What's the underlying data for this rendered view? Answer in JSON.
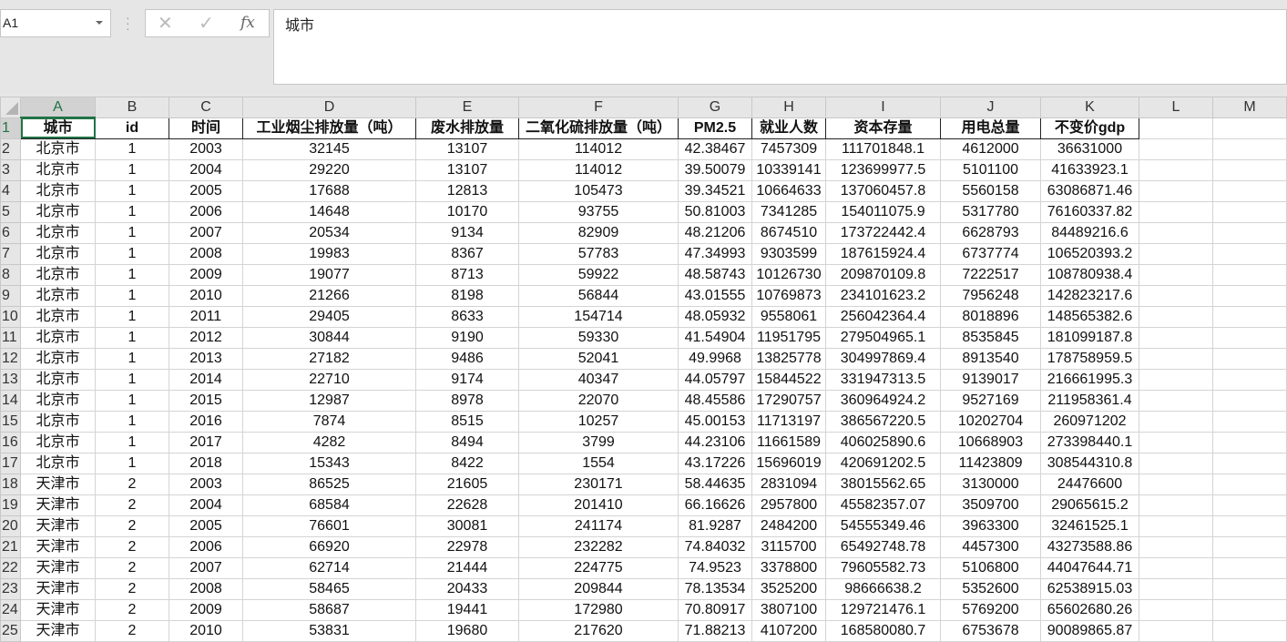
{
  "namebox": "A1",
  "formula_bar": {
    "cancel_icon": "✕",
    "enter_icon": "✓",
    "fx_label": "fx",
    "content": "城市"
  },
  "column_letters": [
    "A",
    "B",
    "C",
    "D",
    "E",
    "F",
    "G",
    "H",
    "I",
    "J",
    "K",
    "L",
    "M"
  ],
  "headers": [
    "城市",
    "id",
    "时间",
    "工业烟尘排放量（吨）",
    "废水排放量",
    "二氧化硫排放量（吨）",
    "PM2.5",
    "就业人数",
    "资本存量",
    "用电总量",
    "不变价gdp"
  ],
  "rows": [
    [
      "北京市",
      "1",
      "2003",
      "32145",
      "13107",
      "114012",
      "42.38467",
      "7457309",
      "111701848.1",
      "4612000",
      "36631000"
    ],
    [
      "北京市",
      "1",
      "2004",
      "29220",
      "13107",
      "114012",
      "39.50079",
      "10339141",
      "123699977.5",
      "5101100",
      "41633923.1"
    ],
    [
      "北京市",
      "1",
      "2005",
      "17688",
      "12813",
      "105473",
      "39.34521",
      "10664633",
      "137060457.8",
      "5560158",
      "63086871.46"
    ],
    [
      "北京市",
      "1",
      "2006",
      "14648",
      "10170",
      "93755",
      "50.81003",
      "7341285",
      "154011075.9",
      "5317780",
      "76160337.82"
    ],
    [
      "北京市",
      "1",
      "2007",
      "20534",
      "9134",
      "82909",
      "48.21206",
      "8674510",
      "173722442.4",
      "6628793",
      "84489216.6"
    ],
    [
      "北京市",
      "1",
      "2008",
      "19983",
      "8367",
      "57783",
      "47.34993",
      "9303599",
      "187615924.4",
      "6737774",
      "106520393.2"
    ],
    [
      "北京市",
      "1",
      "2009",
      "19077",
      "8713",
      "59922",
      "48.58743",
      "10126730",
      "209870109.8",
      "7222517",
      "108780938.4"
    ],
    [
      "北京市",
      "1",
      "2010",
      "21266",
      "8198",
      "56844",
      "43.01555",
      "10769873",
      "234101623.2",
      "7956248",
      "142823217.6"
    ],
    [
      "北京市",
      "1",
      "2011",
      "29405",
      "8633",
      "154714",
      "48.05932",
      "9558061",
      "256042364.4",
      "8018896",
      "148565382.6"
    ],
    [
      "北京市",
      "1",
      "2012",
      "30844",
      "9190",
      "59330",
      "41.54904",
      "11951795",
      "279504965.1",
      "8535845",
      "181099187.8"
    ],
    [
      "北京市",
      "1",
      "2013",
      "27182",
      "9486",
      "52041",
      "49.9968",
      "13825778",
      "304997869.4",
      "8913540",
      "178758959.5"
    ],
    [
      "北京市",
      "1",
      "2014",
      "22710",
      "9174",
      "40347",
      "44.05797",
      "15844522",
      "331947313.5",
      "9139017",
      "216661995.3"
    ],
    [
      "北京市",
      "1",
      "2015",
      "12987",
      "8978",
      "22070",
      "48.45586",
      "17290757",
      "360964924.2",
      "9527169",
      "211958361.4"
    ],
    [
      "北京市",
      "1",
      "2016",
      "7874",
      "8515",
      "10257",
      "45.00153",
      "11713197",
      "386567220.5",
      "10202704",
      "260971202"
    ],
    [
      "北京市",
      "1",
      "2017",
      "4282",
      "8494",
      "3799",
      "44.23106",
      "11661589",
      "406025890.6",
      "10668903",
      "273398440.1"
    ],
    [
      "北京市",
      "1",
      "2018",
      "15343",
      "8422",
      "1554",
      "43.17226",
      "15696019",
      "420691202.5",
      "11423809",
      "308544310.8"
    ],
    [
      "天津市",
      "2",
      "2003",
      "86525",
      "21605",
      "230171",
      "58.44635",
      "2831094",
      "38015562.65",
      "3130000",
      "24476600"
    ],
    [
      "天津市",
      "2",
      "2004",
      "68584",
      "22628",
      "201410",
      "66.16626",
      "2957800",
      "45582357.07",
      "3509700",
      "29065615.2"
    ],
    [
      "天津市",
      "2",
      "2005",
      "76601",
      "30081",
      "241174",
      "81.9287",
      "2484200",
      "54555349.46",
      "3963300",
      "32461525.1"
    ],
    [
      "天津市",
      "2",
      "2006",
      "66920",
      "22978",
      "232282",
      "74.84032",
      "3115700",
      "65492748.78",
      "4457300",
      "43273588.86"
    ],
    [
      "天津市",
      "2",
      "2007",
      "62714",
      "21444",
      "224775",
      "74.9523",
      "3378800",
      "79605582.73",
      "5106800",
      "44047644.71"
    ],
    [
      "天津市",
      "2",
      "2008",
      "58465",
      "20433",
      "209844",
      "78.13534",
      "3525200",
      "98666638.2",
      "5352600",
      "62538915.03"
    ],
    [
      "天津市",
      "2",
      "2009",
      "58687",
      "19441",
      "172980",
      "70.80917",
      "3807100",
      "129721476.1",
      "5769200",
      "65602680.26"
    ],
    [
      "天津市",
      "2",
      "2010",
      "53831",
      "19680",
      "217620",
      "71.88213",
      "4107200",
      "168580080.7",
      "6753678",
      "90089865.87"
    ]
  ]
}
